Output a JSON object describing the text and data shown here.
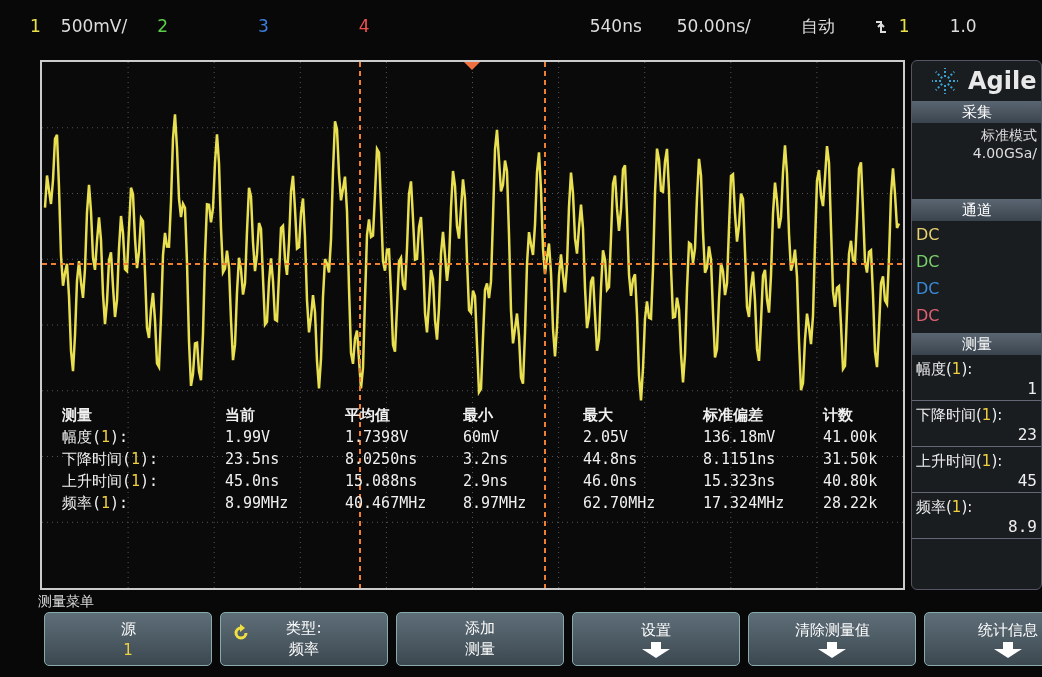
{
  "top_bar": {
    "channels": [
      {
        "number": "1",
        "scale": "500mV/",
        "color": "#e8e04a"
      },
      {
        "number": "2",
        "color": "#5ccf4a"
      },
      {
        "number": "3",
        "color": "#3a7fe0"
      },
      {
        "number": "4",
        "color": "#f05050"
      }
    ],
    "delay": "540ns",
    "timebase": "50.00ns/",
    "trigger_mode": "自动",
    "trigger_source": "1",
    "trigger_level": "1.0"
  },
  "measurements_table": {
    "columns": [
      "测量",
      "当前",
      "平均值",
      "最小",
      "最大",
      "标准偏差",
      "计数"
    ],
    "rows": [
      {
        "name": "幅度(",
        "channel": "1",
        "end": "):",
        "values": [
          "1.99V",
          "1.7398V",
          "60mV",
          "2.05V",
          "136.18mV",
          "41.00k"
        ]
      },
      {
        "name": "下降时间(",
        "channel": "1",
        "end": "):",
        "values": [
          "23.5ns",
          "8.0250ns",
          "3.2ns",
          "44.8ns",
          "8.1151ns",
          "31.50k"
        ]
      },
      {
        "name": "上升时间(",
        "channel": "1",
        "end": "):",
        "values": [
          "45.0ns",
          "15.088ns",
          "2.9ns",
          "46.0ns",
          "15.323ns",
          "40.80k"
        ]
      },
      {
        "name": "频率(",
        "channel": "1",
        "end": "):",
        "values": [
          "8.99MHz",
          "40.467MHz",
          "8.97MHz",
          "62.70MHz",
          "17.324MHz",
          "28.22k"
        ]
      }
    ]
  },
  "side_panel": {
    "brand": "Agile",
    "acquisition": {
      "title": "采集",
      "mode": "标准模式",
      "rate": "4.00GSa/"
    },
    "channels": {
      "title": "通道",
      "items": [
        {
          "coupling": "DC",
          "color": "#e8d070"
        },
        {
          "coupling": "DC",
          "color": "#7ad06a"
        },
        {
          "coupling": "DC",
          "color": "#3a8ad8"
        },
        {
          "coupling": "DC",
          "color": "#e06070"
        }
      ]
    },
    "measure": {
      "title": "测量",
      "items": [
        {
          "name": "幅度(",
          "channel": "1",
          "end": "):",
          "value": "1"
        },
        {
          "name": "下降时间(",
          "channel": "1",
          "end": "):",
          "value": "23"
        },
        {
          "name": "上升时间(",
          "channel": "1",
          "end": "):",
          "value": "45"
        },
        {
          "name": "频率(",
          "channel": "1",
          "end": "):",
          "value": "8.9"
        }
      ]
    }
  },
  "softkey_menu": {
    "title": "测量菜单",
    "buttons": [
      {
        "kind": "value",
        "label": "源",
        "value": "1"
      },
      {
        "kind": "cycle",
        "label": "类型:",
        "value": "频率"
      },
      {
        "kind": "value",
        "label": "添加",
        "value": "测量"
      },
      {
        "kind": "submenu",
        "label": "设置"
      },
      {
        "kind": "submenu",
        "label": "清除测量值"
      },
      {
        "kind": "submenu",
        "label": "统计信息"
      }
    ]
  }
}
